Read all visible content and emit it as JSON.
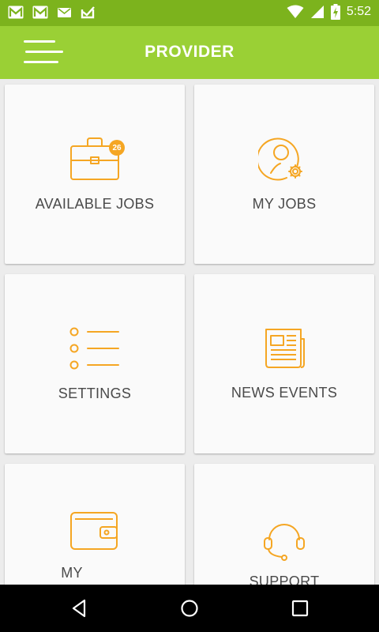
{
  "status_bar": {
    "time": "5:52",
    "left_icons": [
      "gmail-icon",
      "gmail-icon",
      "mail-icon",
      "check-icon"
    ],
    "right_icons": [
      "wifi-icon",
      "signal-icon",
      "battery-charging-icon"
    ]
  },
  "app_bar": {
    "title": "PROVIDER",
    "menu_icon": "menu-icon",
    "color": "#9ad035"
  },
  "tiles": [
    {
      "label": "AVAILABLE JOBS",
      "icon": "briefcase-icon",
      "badge": "26"
    },
    {
      "label": "MY JOBS",
      "icon": "user-settings-icon"
    },
    {
      "label": "SETTINGS",
      "icon": "list-icon"
    },
    {
      "label": "NEWS EVENTS",
      "icon": "newspaper-icon"
    },
    {
      "label": "MY",
      "icon": "wallet-icon"
    },
    {
      "label": "SUPPORT",
      "icon": "headset-icon"
    }
  ],
  "accent_color": "#f5a623",
  "nav_bar": {
    "buttons": [
      "back-icon",
      "home-icon",
      "recents-icon"
    ]
  }
}
